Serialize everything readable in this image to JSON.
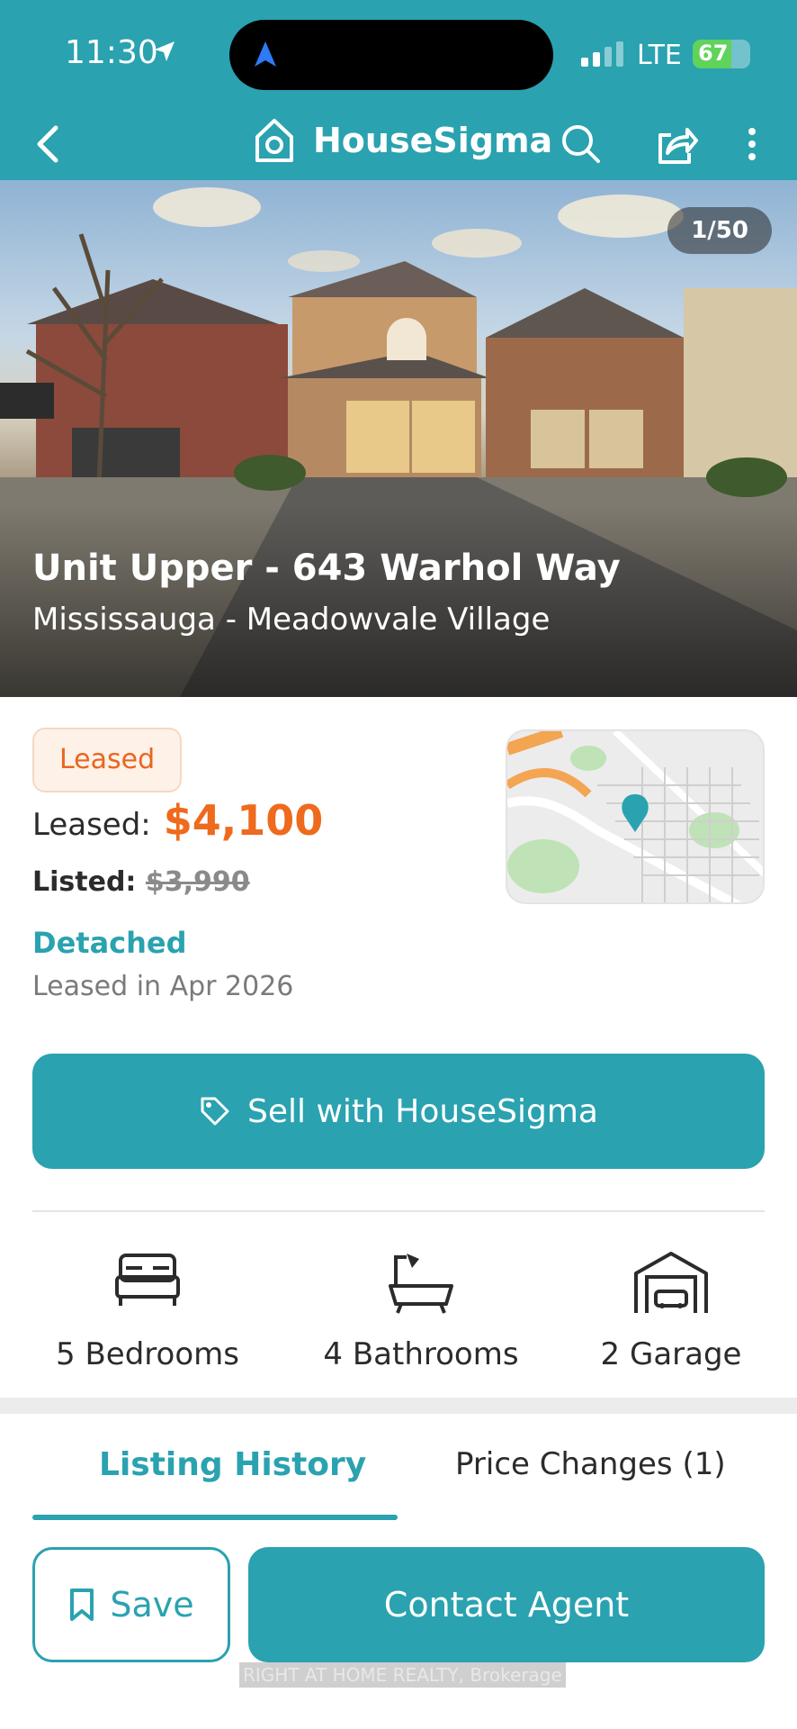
{
  "status_bar": {
    "time": "11:30",
    "carrier": "LTE",
    "battery": "67",
    "battery_level": 0.67
  },
  "header": {
    "brand": "HouseSigma",
    "accent_color": "#2aa2b0",
    "icons": [
      "back-icon",
      "house-logo-icon",
      "search-icon",
      "share-icon",
      "more-icon"
    ]
  },
  "hero": {
    "photo_counter": "1/50",
    "address": "Unit Upper - 643 Warhol Way",
    "area": "Mississauga - Meadowvale Village"
  },
  "listing": {
    "status": "Leased",
    "leased_label": "Leased:",
    "leased_price": "$4,100",
    "listed_label": "Listed:",
    "listed_price": "$3,990",
    "type": "Detached",
    "leased_date": "Leased in Apr 2026",
    "price_color": "#ee6a1c"
  },
  "actions": {
    "sell": "Sell with HouseSigma",
    "save": "Save",
    "contact": "Contact Agent"
  },
  "features": {
    "bedrooms": "5 Bedrooms",
    "bathrooms": "4 Bathrooms",
    "garage": "2 Garage"
  },
  "tabs": {
    "history": "Listing History",
    "price_changes": "Price Changes (1)"
  },
  "footer": {
    "brokerage": "RIGHT AT HOME REALTY, Brokerage"
  }
}
